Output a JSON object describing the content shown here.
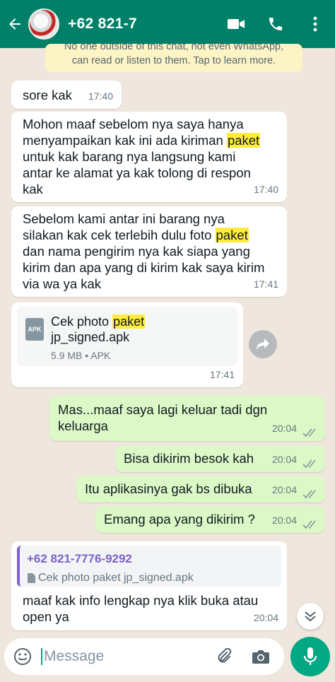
{
  "header": {
    "contact": "+62 821-7",
    "bg_color": "#008069"
  },
  "notice": {
    "line1": "No one outside of this chat, not even WhatsApp,",
    "line2": "can read or listen to them. Tap to learn more."
  },
  "messages": {
    "m1": {
      "text": "sore kak",
      "time": "17:40"
    },
    "m2": {
      "l1": "Mohon maaf sebelom nya saya hanya",
      "l2a": "menyampaikan kak ini ada kiriman ",
      "l2b": "paket",
      "l3": "untuk kak barang nya langsung kami",
      "l4": "antar ke alamat  ya kak tolong di respon",
      "l5": "kak",
      "time": "17:40"
    },
    "m3": {
      "l1": "Sebelom kami antar ini barang nya",
      "l2a": "silakan kak cek terlebih dulu  foto ",
      "l2b": "paket",
      "l3": "dan nama pengirim nya kak siapa yang",
      "l4": "kirim dan apa yang di kirim kak saya kirim",
      "l5": "via wa ya kak",
      "time": "17:41"
    },
    "m4": {
      "icon_text": "APK",
      "name_a": "Cek photo ",
      "name_b": "paket",
      "name_l2": "jp_signed.apk",
      "meta": "5.9 MB • APK",
      "time": "17:41"
    },
    "o1": {
      "l1": "Mas...maaf saya lagi keluar tadi dgn",
      "l2": "keluarga",
      "time": "20:04"
    },
    "o2": {
      "text": "Bisa dikirim besok kah",
      "time": "20:04"
    },
    "o3": {
      "text": "Itu aplikasinya gak bs dibuka",
      "time": "20:04"
    },
    "o4": {
      "text": "Emang apa yang dikirim ?",
      "time": "20:04"
    },
    "m5": {
      "quote_sender": "+62 821-7776-9292",
      "quote_text": "Cek photo paket jp_signed.apk",
      "l1": "maaf kak info lengkap nya klik buka atau",
      "l2": "open ya",
      "time": "20:04"
    }
  },
  "input": {
    "placeholder": "Message"
  },
  "colors": {
    "incoming": "#ffffff",
    "outgoing": "#dcf8c6",
    "highlight": "#ffec3d",
    "read_ticks": "#8696a0",
    "quote_bar": "#7b61c9"
  }
}
